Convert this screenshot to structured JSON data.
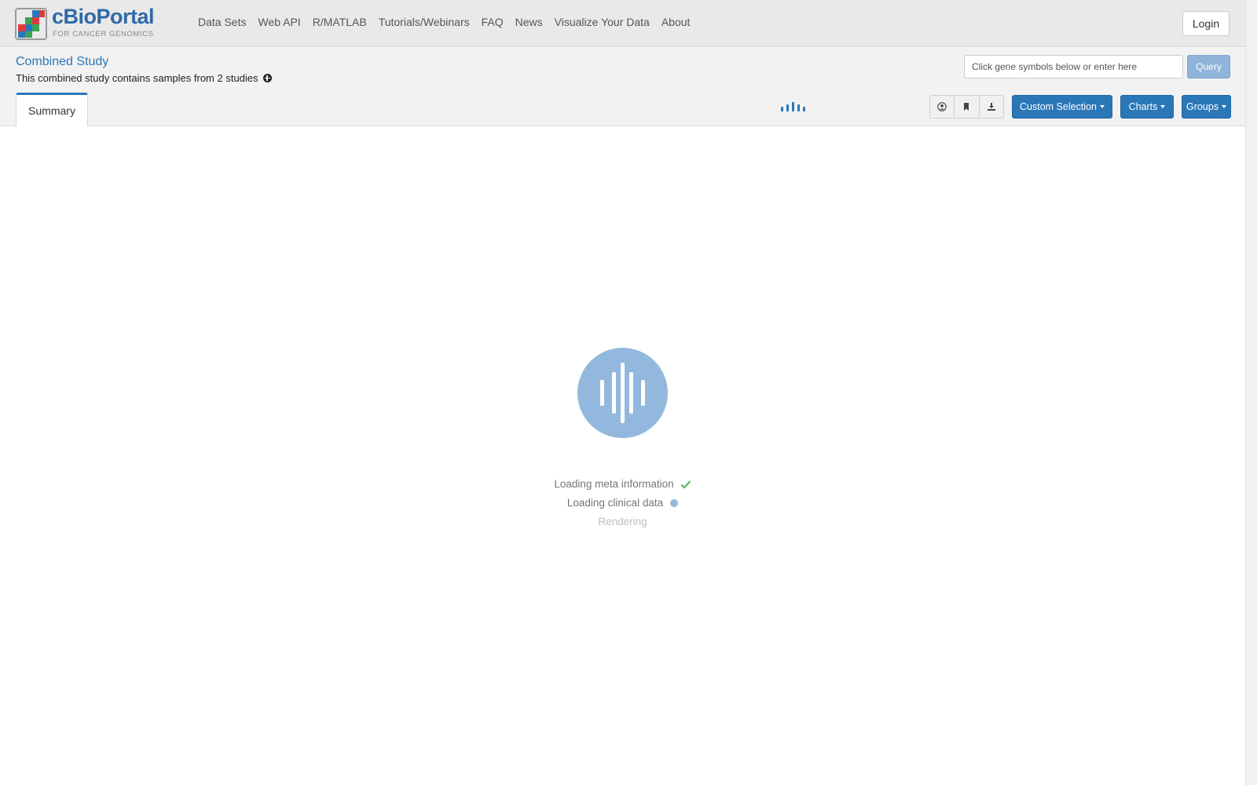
{
  "navbar": {
    "logo_name": "cBioPortal",
    "logo_tag": "FOR CANCER GENOMICS",
    "links": [
      {
        "label": "Data Sets"
      },
      {
        "label": "Web API"
      },
      {
        "label": "R/MATLAB"
      },
      {
        "label": "Tutorials/Webinars"
      },
      {
        "label": "FAQ"
      },
      {
        "label": "News"
      },
      {
        "label": "Visualize Your Data"
      },
      {
        "label": "About"
      }
    ],
    "login_label": "Login"
  },
  "study": {
    "title": "Combined Study",
    "description": "This combined study contains samples from 2 studies"
  },
  "query": {
    "placeholder": "Click gene symbols below or enter here",
    "value": "",
    "button_label": "Query"
  },
  "tabs": [
    {
      "label": "Summary",
      "active": true
    }
  ],
  "toolbar": {
    "icons": [
      "user-circle-icon",
      "bookmark-icon",
      "download-icon"
    ],
    "custom_selection_label": "Custom Selection",
    "charts_label": "Charts",
    "groups_label": "Groups"
  },
  "loading": {
    "steps": [
      {
        "label": "Loading meta information",
        "status": "done"
      },
      {
        "label": "Loading clinical data",
        "status": "in-progress"
      },
      {
        "label": "Rendering",
        "status": "pending"
      }
    ]
  },
  "colors": {
    "brand_blue": "#2a77b8",
    "loader_blue": "#93b8dd",
    "success_green": "#5cb85c",
    "navbar_bg": "#e9e9e9"
  }
}
